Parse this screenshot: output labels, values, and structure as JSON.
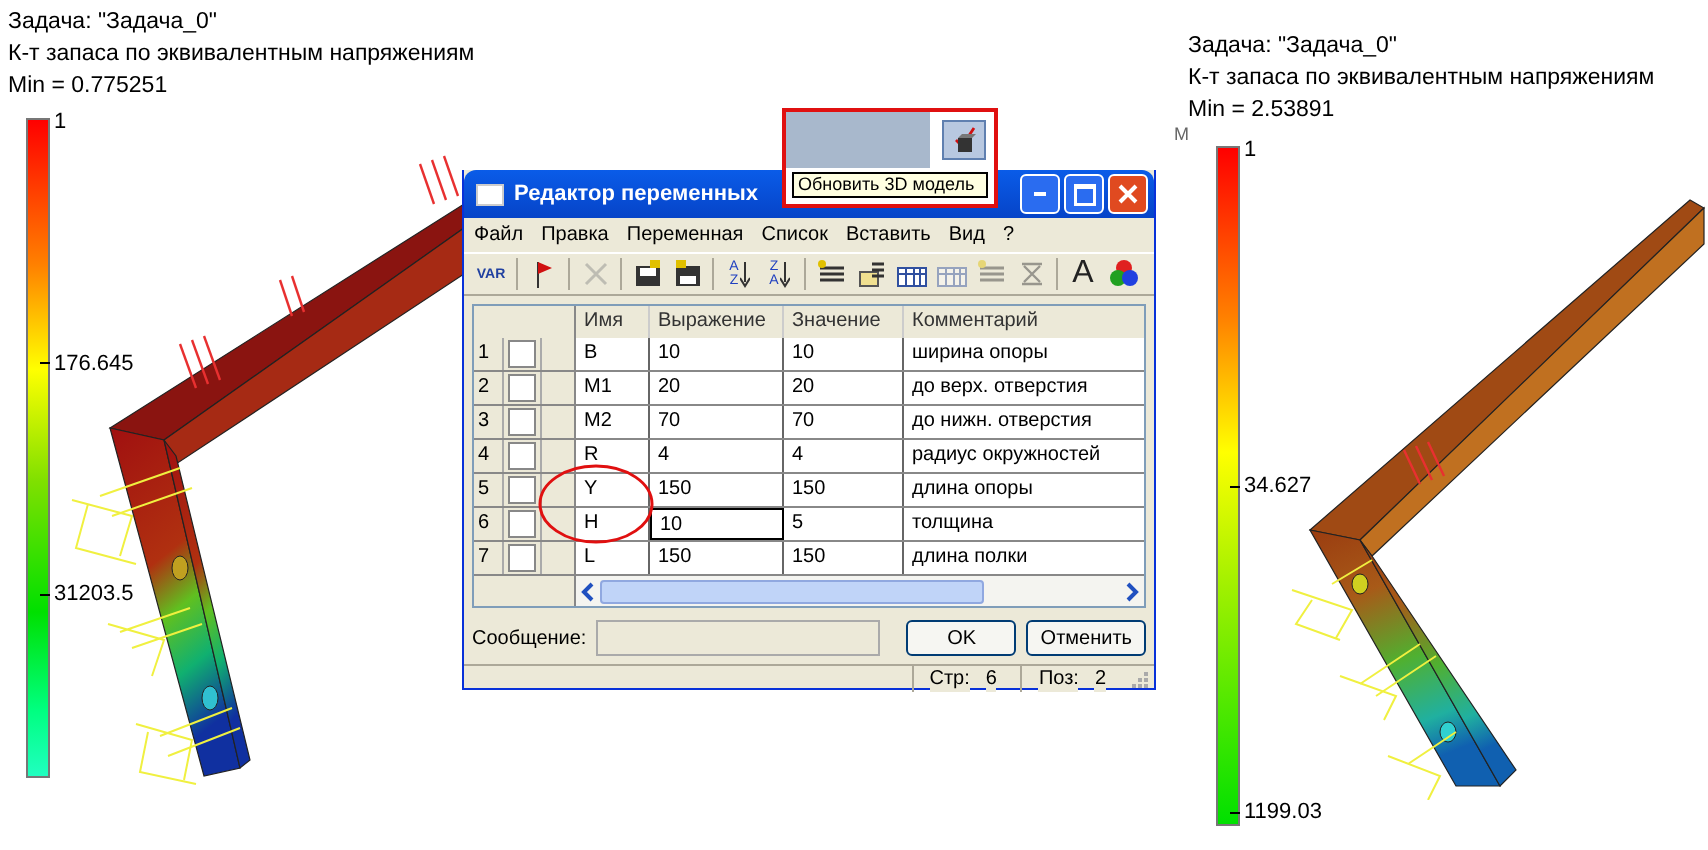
{
  "left_view": {
    "task": "Задача: \"Задача_0\"",
    "quantity": "К-т запаса по эквивалентным напряжениям",
    "min": "Min =  0.775251",
    "scale": [
      {
        "label": "1"
      },
      {
        "label": "176.645"
      },
      {
        "label": "31203.5"
      }
    ]
  },
  "right_view": {
    "edge_letter": "M",
    "task": "Задача: \"Задача_0\"",
    "quantity": "К-т запаса по эквивалентным напряжениям",
    "min": "Min = 2.53891",
    "scale": [
      {
        "label": "1"
      },
      {
        "label": "34.627"
      },
      {
        "label": "1199.03"
      }
    ]
  },
  "update_button": {
    "tooltip": "Обновить 3D модель"
  },
  "dialog": {
    "title": "Редактор переменных",
    "menu": [
      "Файл",
      "Правка",
      "Переменная",
      "Список",
      "Вставить",
      "Вид",
      "?"
    ],
    "toolbar": [
      {
        "kind": "var",
        "label": "VAR",
        "disabled": false
      },
      {
        "kind": "sep"
      },
      {
        "kind": "flag",
        "disabled": false
      },
      {
        "kind": "sep"
      },
      {
        "kind": "delete",
        "disabled": true
      },
      {
        "kind": "sep"
      },
      {
        "kind": "save",
        "disabled": false
      },
      {
        "kind": "load",
        "disabled": false
      },
      {
        "kind": "sep"
      },
      {
        "kind": "sort-az",
        "label": "AZ",
        "disabled": false
      },
      {
        "kind": "sort-za",
        "label": "ZA",
        "disabled": false
      },
      {
        "kind": "sep"
      },
      {
        "kind": "lines",
        "disabled": false
      },
      {
        "kind": "file-lines",
        "disabled": false
      },
      {
        "kind": "table",
        "disabled": false
      },
      {
        "kind": "table",
        "disabled": true
      },
      {
        "kind": "lines",
        "disabled": true
      },
      {
        "kind": "cross",
        "disabled": true
      },
      {
        "kind": "sep"
      },
      {
        "kind": "font",
        "label": "A",
        "disabled": false
      },
      {
        "kind": "colors",
        "disabled": false
      }
    ],
    "columns": [
      "Имя",
      "Выражение",
      "Значение",
      "Комментарий"
    ],
    "rows": [
      {
        "number": "1",
        "checked": false,
        "name": "B",
        "expression": "10",
        "value": "10",
        "comment": "ширина опоры",
        "editing": false
      },
      {
        "number": "2",
        "checked": false,
        "name": "M1",
        "expression": "20",
        "value": "20",
        "comment": "до верх. отверстия",
        "editing": false
      },
      {
        "number": "3",
        "checked": false,
        "name": "M2",
        "expression": "70",
        "value": "70",
        "comment": "до нижн. отверстия",
        "editing": false
      },
      {
        "number": "4",
        "checked": false,
        "name": "R",
        "expression": "4",
        "value": "4",
        "comment": "радиус окружностей",
        "editing": false
      },
      {
        "number": "5",
        "checked": false,
        "name": "Y",
        "expression": "150",
        "value": "150",
        "comment": "длина опоры",
        "editing": false
      },
      {
        "number": "6",
        "checked": false,
        "name": "H",
        "expression": "10",
        "value": "5",
        "comment": "толщина",
        "editing": true
      },
      {
        "number": "7",
        "checked": false,
        "name": "L",
        "expression": "150",
        "value": "150",
        "comment": "длина полки",
        "editing": false
      }
    ],
    "message_label": "Сообщение:",
    "buttons": [
      "OK",
      "Отменить"
    ],
    "status": [
      {
        "label": "Стр:",
        "value": "6"
      },
      {
        "label": "Поз:",
        "value": "2"
      }
    ]
  }
}
